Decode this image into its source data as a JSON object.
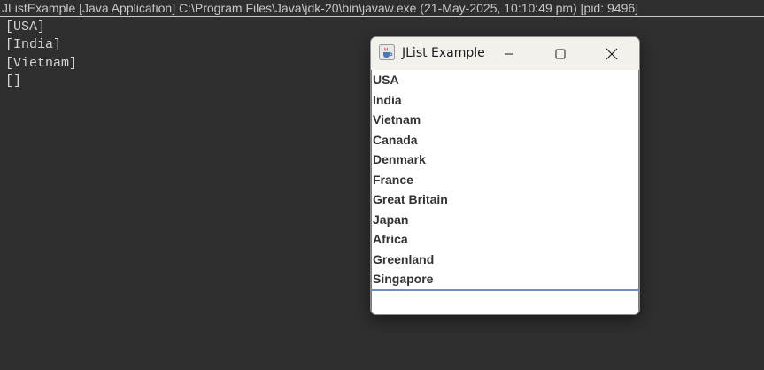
{
  "console": {
    "header": "JListExample [Java Application] C:\\Program Files\\Java\\jdk-20\\bin\\javaw.exe  (21-May-2025, 10:10:49 pm) [pid: 9496]",
    "lines": [
      "[USA]",
      "[India]",
      "[Vietnam]",
      "[]"
    ]
  },
  "window": {
    "title": "JList Example",
    "app_icon": "java-cup-icon",
    "controls": [
      "minimize-icon",
      "maximize-icon",
      "close-icon"
    ],
    "list_items": [
      "USA",
      "India",
      "Vietnam",
      "Canada",
      "Denmark",
      "France",
      "Great Britain",
      "Japan",
      "Africa",
      "Greenland",
      "Singapore"
    ],
    "text_field_value": ""
  },
  "colors": {
    "console_bg": "#2f2f2f",
    "console_text": "#d4d4d4",
    "window_bg": "#f3f1ec",
    "list_text": "#333333",
    "selection_line": "#6f8fc8"
  }
}
